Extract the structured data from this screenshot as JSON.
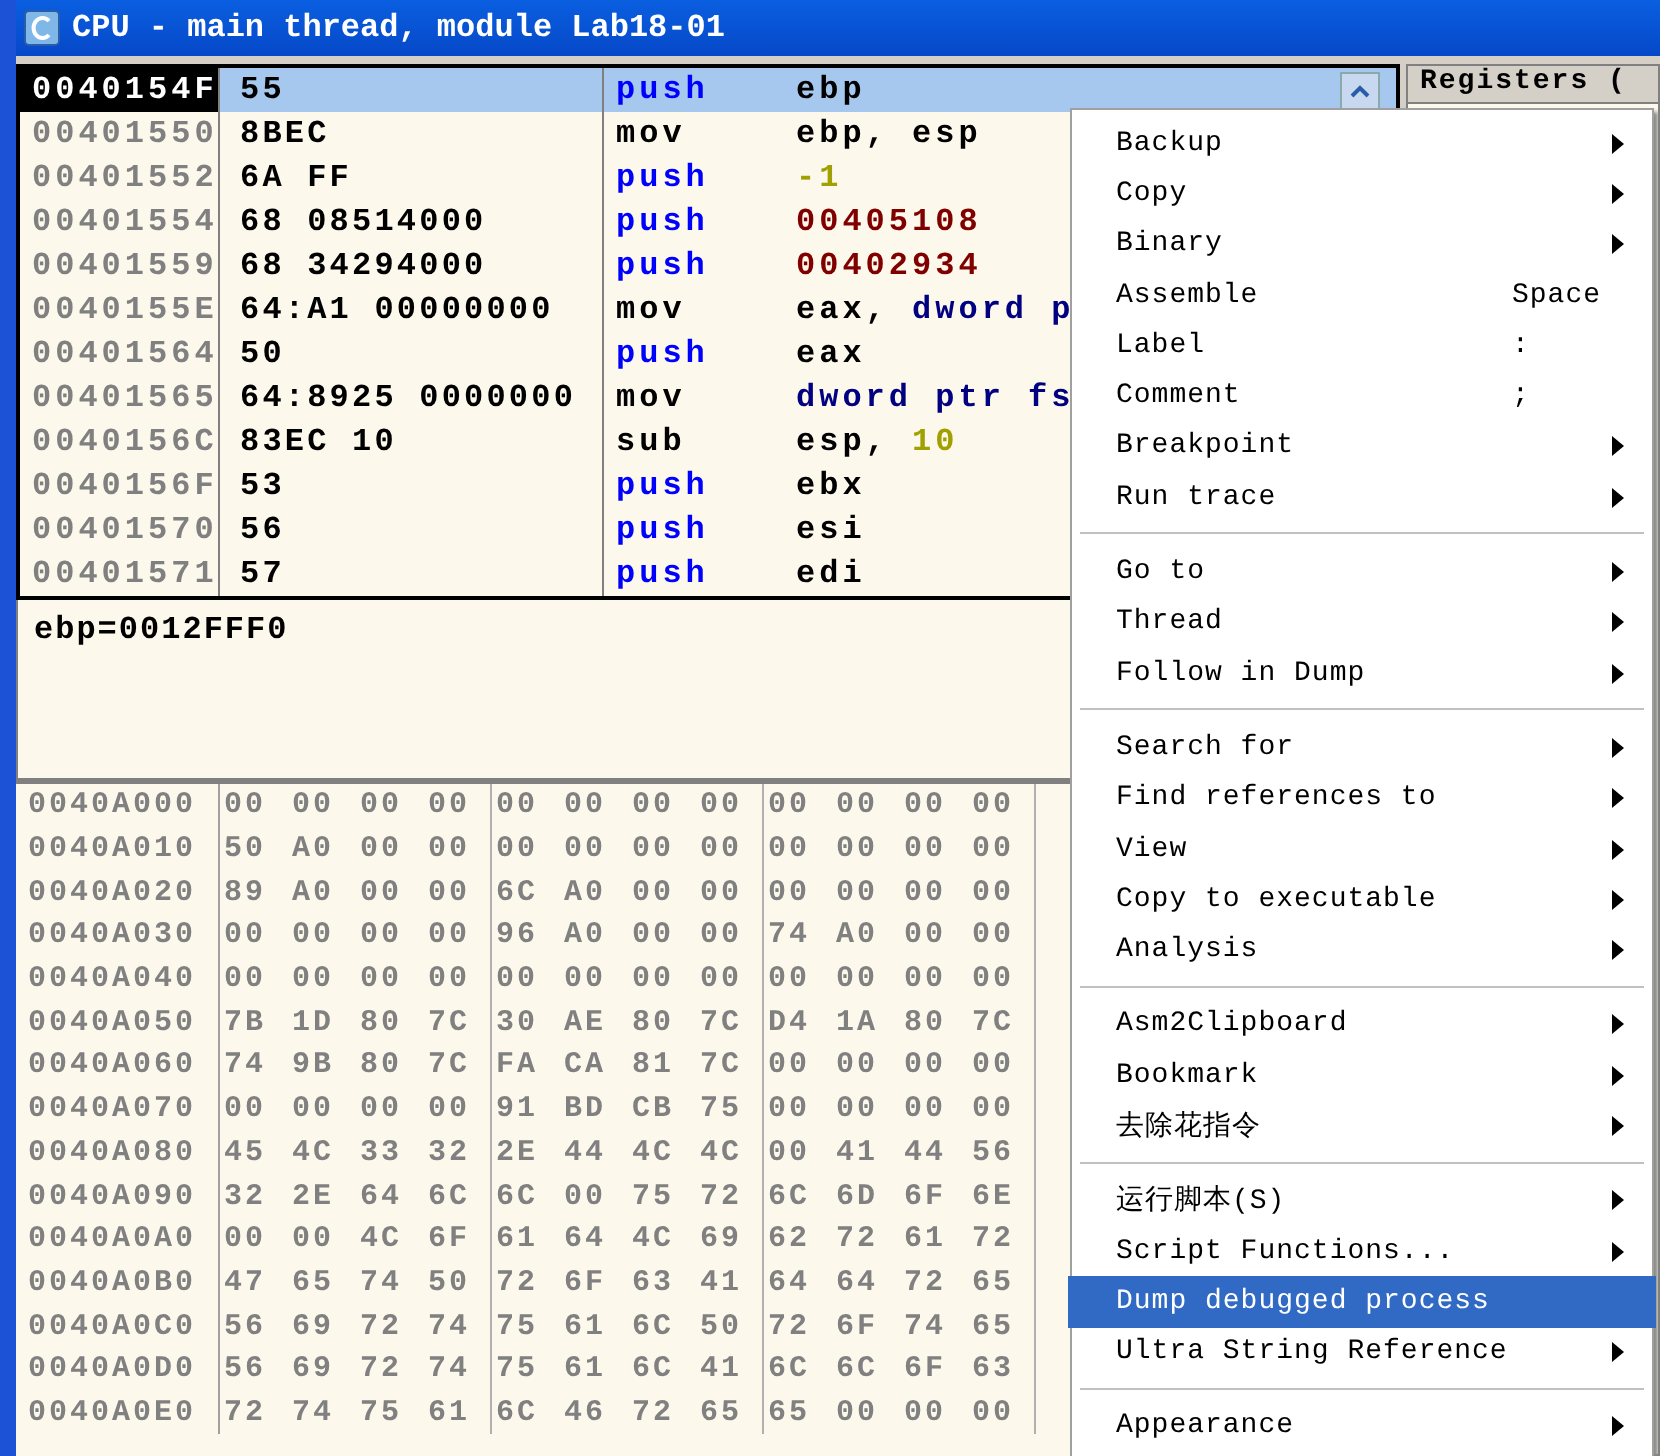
{
  "window": {
    "title": "CPU - main thread, module Lab18-01"
  },
  "disassembly": [
    {
      "address": "0040154F",
      "hex": "55",
      "mnemonic": "push",
      "kind": "stack",
      "operands": [
        {
          "text": "ebp",
          "kind": "plain"
        }
      ],
      "selected": true
    },
    {
      "address": "00401550",
      "hex": "8BEC",
      "mnemonic": "mov",
      "kind": "plain",
      "operands": [
        {
          "text": "ebp, esp",
          "kind": "plain"
        }
      ],
      "selected": false
    },
    {
      "address": "00401552",
      "hex": "6A FF",
      "mnemonic": "push",
      "kind": "stack",
      "operands": [
        {
          "text": "-1",
          "kind": "number"
        }
      ],
      "selected": false
    },
    {
      "address": "00401554",
      "hex": "68 08514000",
      "mnemonic": "push",
      "kind": "stack",
      "operands": [
        {
          "text": "00405108",
          "kind": "address"
        }
      ],
      "selected": false
    },
    {
      "address": "00401559",
      "hex": "68 34294000",
      "mnemonic": "push",
      "kind": "stack",
      "operands": [
        {
          "text": "00402934",
          "kind": "address"
        }
      ],
      "selected": false
    },
    {
      "address": "0040155E",
      "hex": "64:A1 00000000",
      "mnemonic": "mov",
      "kind": "plain",
      "operands": [
        {
          "text": "eax, ",
          "kind": "plain"
        },
        {
          "text": "dword p",
          "kind": "keyword"
        }
      ],
      "selected": false
    },
    {
      "address": "00401564",
      "hex": "50",
      "mnemonic": "push",
      "kind": "stack",
      "operands": [
        {
          "text": "eax",
          "kind": "plain"
        }
      ],
      "selected": false
    },
    {
      "address": "00401565",
      "hex": "64:8925 0000000",
      "mnemonic": "mov",
      "kind": "plain",
      "operands": [
        {
          "text": "dword ptr fs",
          "kind": "keyword"
        }
      ],
      "selected": false
    },
    {
      "address": "0040156C",
      "hex": "83EC 10",
      "mnemonic": "sub",
      "kind": "plain",
      "operands": [
        {
          "text": "esp, ",
          "kind": "plain"
        },
        {
          "text": "10",
          "kind": "number"
        }
      ],
      "selected": false
    },
    {
      "address": "0040156F",
      "hex": "53",
      "mnemonic": "push",
      "kind": "stack",
      "operands": [
        {
          "text": "ebx",
          "kind": "plain"
        }
      ],
      "selected": false
    },
    {
      "address": "00401570",
      "hex": "56",
      "mnemonic": "push",
      "kind": "stack",
      "operands": [
        {
          "text": "esi",
          "kind": "plain"
        }
      ],
      "selected": false
    },
    {
      "address": "00401571",
      "hex": "57",
      "mnemonic": "push",
      "kind": "stack",
      "operands": [
        {
          "text": "edi",
          "kind": "plain"
        }
      ],
      "selected": false
    }
  ],
  "info": "ebp=0012FFF0",
  "registers": {
    "title": "Registers ("
  },
  "dump": [
    {
      "address": "0040A000",
      "bytes": [
        "00",
        "00",
        "00",
        "00",
        "00",
        "00",
        "00",
        "00",
        "00",
        "00",
        "00",
        "00"
      ]
    },
    {
      "address": "0040A010",
      "bytes": [
        "50",
        "A0",
        "00",
        "00",
        "00",
        "00",
        "00",
        "00",
        "00",
        "00",
        "00",
        "00"
      ]
    },
    {
      "address": "0040A020",
      "bytes": [
        "89",
        "A0",
        "00",
        "00",
        "6C",
        "A0",
        "00",
        "00",
        "00",
        "00",
        "00",
        "00"
      ]
    },
    {
      "address": "0040A030",
      "bytes": [
        "00",
        "00",
        "00",
        "00",
        "96",
        "A0",
        "00",
        "00",
        "74",
        "A0",
        "00",
        "00"
      ]
    },
    {
      "address": "0040A040",
      "bytes": [
        "00",
        "00",
        "00",
        "00",
        "00",
        "00",
        "00",
        "00",
        "00",
        "00",
        "00",
        "00"
      ]
    },
    {
      "address": "0040A050",
      "bytes": [
        "7B",
        "1D",
        "80",
        "7C",
        "30",
        "AE",
        "80",
        "7C",
        "D4",
        "1A",
        "80",
        "7C"
      ]
    },
    {
      "address": "0040A060",
      "bytes": [
        "74",
        "9B",
        "80",
        "7C",
        "FA",
        "CA",
        "81",
        "7C",
        "00",
        "00",
        "00",
        "00"
      ]
    },
    {
      "address": "0040A070",
      "bytes": [
        "00",
        "00",
        "00",
        "00",
        "91",
        "BD",
        "CB",
        "75",
        "00",
        "00",
        "00",
        "00"
      ]
    },
    {
      "address": "0040A080",
      "bytes": [
        "45",
        "4C",
        "33",
        "32",
        "2E",
        "44",
        "4C",
        "4C",
        "00",
        "41",
        "44",
        "56"
      ]
    },
    {
      "address": "0040A090",
      "bytes": [
        "32",
        "2E",
        "64",
        "6C",
        "6C",
        "00",
        "75",
        "72",
        "6C",
        "6D",
        "6F",
        "6E"
      ]
    },
    {
      "address": "0040A0A0",
      "bytes": [
        "00",
        "00",
        "4C",
        "6F",
        "61",
        "64",
        "4C",
        "69",
        "62",
        "72",
        "61",
        "72"
      ]
    },
    {
      "address": "0040A0B0",
      "bytes": [
        "47",
        "65",
        "74",
        "50",
        "72",
        "6F",
        "63",
        "41",
        "64",
        "64",
        "72",
        "65"
      ]
    },
    {
      "address": "0040A0C0",
      "bytes": [
        "56",
        "69",
        "72",
        "74",
        "75",
        "61",
        "6C",
        "50",
        "72",
        "6F",
        "74",
        "65"
      ]
    },
    {
      "address": "0040A0D0",
      "bytes": [
        "56",
        "69",
        "72",
        "74",
        "75",
        "61",
        "6C",
        "41",
        "6C",
        "6C",
        "6F",
        "63"
      ]
    },
    {
      "address": "0040A0E0",
      "bytes": [
        "72",
        "74",
        "75",
        "61",
        "6C",
        "46",
        "72",
        "65",
        "65",
        "00",
        "00",
        "00"
      ]
    }
  ],
  "context_menu": {
    "groups": [
      [
        {
          "label": "Backup",
          "submenu": true,
          "selected": false
        },
        {
          "label": "Copy",
          "submenu": true,
          "selected": false
        },
        {
          "label": "Binary",
          "submenu": true,
          "selected": false
        },
        {
          "label": "Assemble",
          "shortcut": "Space",
          "submenu": false,
          "selected": false
        },
        {
          "label": "Label",
          "shortcut": ":",
          "submenu": false,
          "selected": false
        },
        {
          "label": "Comment",
          "shortcut": ";",
          "submenu": false,
          "selected": false
        },
        {
          "label": "Breakpoint",
          "submenu": true,
          "selected": false
        },
        {
          "label": "Run trace",
          "submenu": true,
          "selected": false
        }
      ],
      [
        {
          "label": "Go to",
          "submenu": true,
          "selected": false
        },
        {
          "label": "Thread",
          "submenu": true,
          "selected": false
        },
        {
          "label": "Follow in Dump",
          "submenu": true,
          "selected": false
        }
      ],
      [
        {
          "label": "Search for",
          "submenu": true,
          "selected": false
        },
        {
          "label": "Find references to",
          "submenu": true,
          "selected": false
        },
        {
          "label": "View",
          "submenu": true,
          "selected": false
        },
        {
          "label": "Copy to executable",
          "submenu": true,
          "selected": false
        },
        {
          "label": "Analysis",
          "submenu": true,
          "selected": false
        }
      ],
      [
        {
          "label": "Asm2Clipboard",
          "submenu": true,
          "selected": false
        },
        {
          "label": "Bookmark",
          "submenu": true,
          "selected": false
        },
        {
          "label": "去除花指令",
          "submenu": true,
          "selected": false
        }
      ],
      [
        {
          "label": "运行脚本(S)",
          "submenu": true,
          "selected": false
        },
        {
          "label": "Script Functions...",
          "submenu": true,
          "selected": false
        },
        {
          "label": "Dump debugged process",
          "submenu": false,
          "selected": true
        },
        {
          "label": "Ultra String Reference",
          "submenu": true,
          "selected": false
        }
      ],
      [
        {
          "label": "Appearance",
          "submenu": true,
          "selected": false
        }
      ]
    ]
  }
}
